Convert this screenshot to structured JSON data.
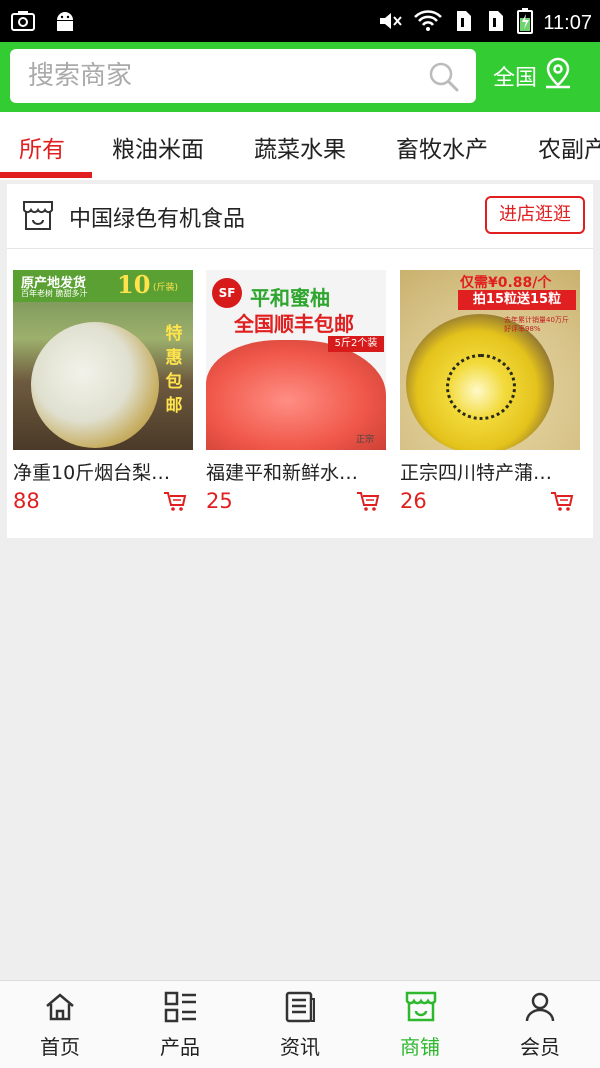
{
  "status_bar": {
    "time": "11:07",
    "left_icons": [
      "screenshot-icon",
      "android-icon"
    ],
    "right_icons": [
      "mute-icon",
      "wifi-icon",
      "sim1-icon",
      "sim2-icon",
      "battery-charging-icon"
    ]
  },
  "search": {
    "placeholder": "搜索商家",
    "value": "",
    "icon": "search-icon",
    "region_label": "全国",
    "region_icon": "location-pin-icon"
  },
  "tabs": [
    {
      "label": "所有",
      "active": true
    },
    {
      "label": "粮油米面",
      "active": false
    },
    {
      "label": "蔬菜水果",
      "active": false
    },
    {
      "label": "畜牧水产",
      "active": false
    },
    {
      "label": "农副产",
      "active": false
    }
  ],
  "shop": {
    "icon": "shop-icon",
    "name": "中国绿色有机食品",
    "enter_label": "进店逛逛",
    "products": [
      {
        "title": "净重10斤烟台梨…",
        "price": "88",
        "cart_icon": "cart-icon",
        "image_text": {
          "line1": "原产地发货",
          "line2": "百年老树 脆甜多汁",
          "big": "10",
          "unit": "(斤装)",
          "vertical": [
            "特",
            "惠",
            "包",
            "邮"
          ]
        }
      },
      {
        "title": "福建平和新鲜水…",
        "price": "25",
        "cart_icon": "cart-icon",
        "image_text": {
          "logo": "SF",
          "line1": "平和蜜柚",
          "line2": "全国顺丰包邮",
          "tag": "5斤2个装",
          "corner": "正宗"
        }
      },
      {
        "title": "正宗四川特产蒲…",
        "price": "26",
        "cart_icon": "cart-icon",
        "image_text": {
          "line1": "仅需¥0.88/个",
          "line2": "拍15粒送15粒",
          "note1": "去年累计销量40万斤",
          "note2": "好评率98%"
        }
      }
    ]
  },
  "bottom_nav": [
    {
      "label": "首页",
      "icon": "home-icon",
      "active": false
    },
    {
      "label": "产品",
      "icon": "product-grid-icon",
      "active": false
    },
    {
      "label": "资讯",
      "icon": "news-icon",
      "active": false
    },
    {
      "label": "商铺",
      "icon": "store-icon",
      "active": true
    },
    {
      "label": "会员",
      "icon": "member-icon",
      "active": false
    }
  ],
  "colors": {
    "brand_green": "#33cc33",
    "accent_red": "#e02020",
    "active_nav": "#2db82d"
  }
}
